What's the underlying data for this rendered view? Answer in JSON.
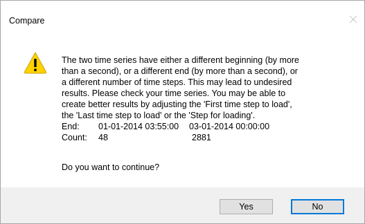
{
  "window": {
    "title": "Compare"
  },
  "message": {
    "lines": [
      "The two time series have either a different beginning (by more",
      "than a second), or a different end (by more than a second), or",
      "a different number of time steps. This may lead to undesired",
      "results. Please check your time series. You may be able to",
      "create better results by adjusting the 'First time step to load',",
      "the 'Last time step to load' or the 'Step for loading'."
    ],
    "end_label": "End:",
    "end_value_1": "01-01-2014 03:55:00",
    "end_value_2": "03-01-2014 00:00:00",
    "count_label": "Count:",
    "count_value_1": "48",
    "count_value_2": "2881",
    "question": "Do you want to continue?"
  },
  "buttons": {
    "yes_label": "Yes",
    "no_label": "No"
  },
  "icons": {
    "warning": "warning-icon",
    "close": "close-icon"
  },
  "colors": {
    "warning_fill": "#ffd200",
    "focus_border": "#0078d7",
    "footer_bg": "#f0f0f0"
  }
}
